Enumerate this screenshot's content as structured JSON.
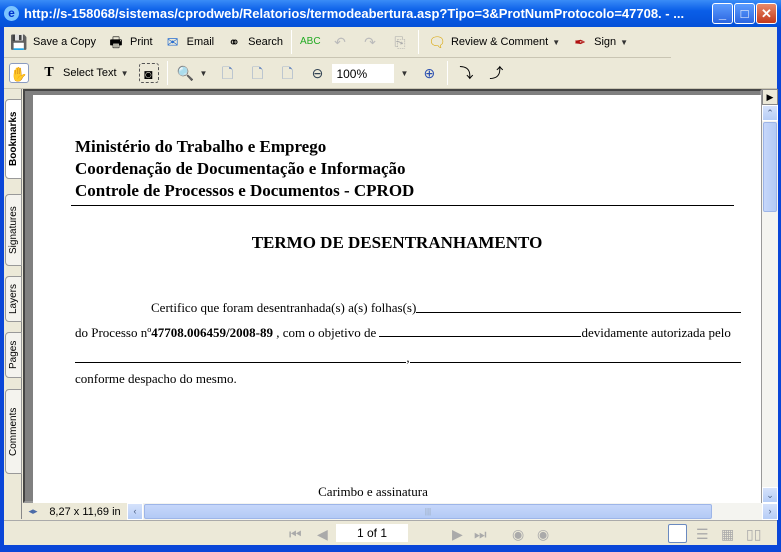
{
  "window": {
    "title": "http://s-158068/sistemas/cprodweb/Relatorios/termodeabertura.asp?Tipo=3&ProtNumProtocolo=47708. - ..."
  },
  "toolbar1": {
    "save_copy": "Save a Copy",
    "print": "Print",
    "email": "Email",
    "search": "Search",
    "review": "Review & Comment",
    "sign": "Sign"
  },
  "toolbar2": {
    "select_text": "Select Text",
    "zoom": "100%"
  },
  "nav_tabs": [
    "Bookmarks",
    "Signatures",
    "Layers",
    "Pages",
    "Comments"
  ],
  "document": {
    "header": [
      "Ministério do Trabalho e Emprego",
      "Coordenação de Documentação e Informação",
      "Controle de Processos e Documentos - CPROD"
    ],
    "title": "TERMO DE DESENTRANHAMENTO",
    "line1": "Certifico que foram desentranhada(s) a(s) folhas(s)",
    "line2_a": "do Processo nº",
    "process_number": "47708.006459/2008-89",
    "line2_b": " , com o objetivo de ",
    "line2_c": "devidamente autorizada pelo",
    "line3_sep": ",",
    "line4": "conforme despacho do mesmo.",
    "signature": "Carimbo e assinatura"
  },
  "status": {
    "page_size": "8,27 x 11,69 in",
    "page_indicator": "1 of 1"
  }
}
